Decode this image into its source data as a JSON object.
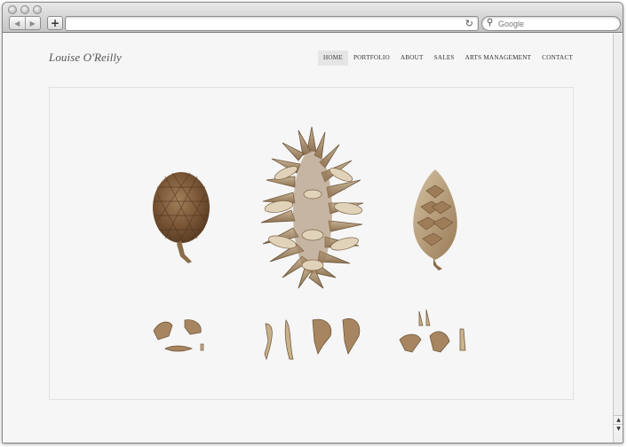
{
  "browser": {
    "search_placeholder": "Google",
    "reload_glyph": "↻",
    "search_glyph": "⚲",
    "back_glyph": "◀",
    "forward_glyph": "▶",
    "add_glyph": "+"
  },
  "site": {
    "logo": "Louise O'Reilly",
    "nav": {
      "home": "HOME",
      "portfolio": "PORTFOLIO",
      "about": "ABOUT",
      "sales": "SALES",
      "arts_management": "ARTS MANAGEMENT",
      "contact": "CONTACT"
    },
    "active_nav": "home"
  },
  "colors": {
    "cone_dark": "#6b4a2e",
    "cone_mid": "#8e6c47",
    "cone_light": "#b69d7a",
    "cone_pale": "#cdb99a",
    "page_bg": "#f6f6f6"
  },
  "icons": {
    "reload": "reload-icon",
    "search": "search-icon",
    "back": "back-arrow-icon",
    "forward": "forward-arrow-icon",
    "add_tab": "add-bookmark-icon"
  }
}
